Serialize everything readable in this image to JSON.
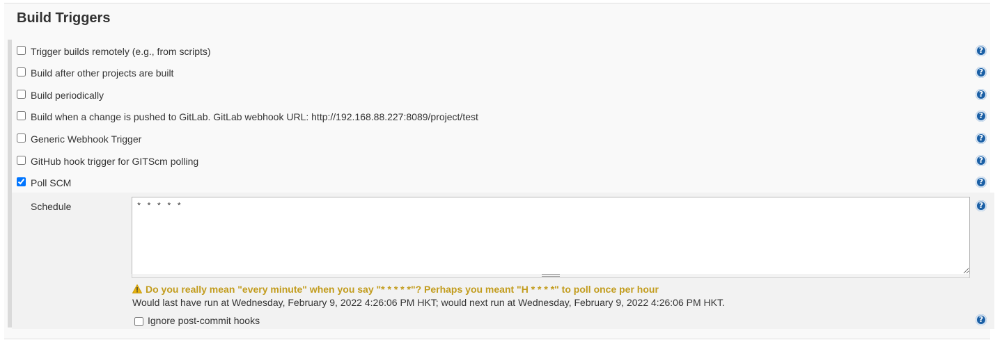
{
  "section": {
    "title": "Build Triggers"
  },
  "triggers": [
    {
      "label": "Trigger builds remotely (e.g., from scripts)",
      "checked": false
    },
    {
      "label": "Build after other projects are built",
      "checked": false
    },
    {
      "label": "Build periodically",
      "checked": false
    },
    {
      "label": "Build when a change is pushed to GitLab. GitLab webhook URL: http://192.168.88.227:8089/project/test",
      "checked": false
    },
    {
      "label": "Generic Webhook Trigger",
      "checked": false
    },
    {
      "label": "GitHub hook trigger for GITScm polling",
      "checked": false
    },
    {
      "label": "Poll SCM",
      "checked": true
    }
  ],
  "poll_scm": {
    "schedule_label": "Schedule",
    "schedule_value": "* * * * *",
    "warning": "Do you really mean \"every minute\" when you say \"* * * * *\"? Perhaps you meant \"H * * * *\" to poll once per hour",
    "info": "Would last have run at Wednesday, February 9, 2022 4:26:06 PM HKT; would next run at Wednesday, February 9, 2022 4:26:06 PM HKT.",
    "ignore_post_commit_label": "Ignore post-commit hooks",
    "ignore_post_commit_checked": false
  },
  "help_icon_glyph": "?",
  "colors": {
    "help_icon": "#1a5fa5",
    "warning_text": "#c29c1d",
    "panel_bg": "#f9f9f9",
    "subpanel_bg": "#f2f2f2"
  }
}
